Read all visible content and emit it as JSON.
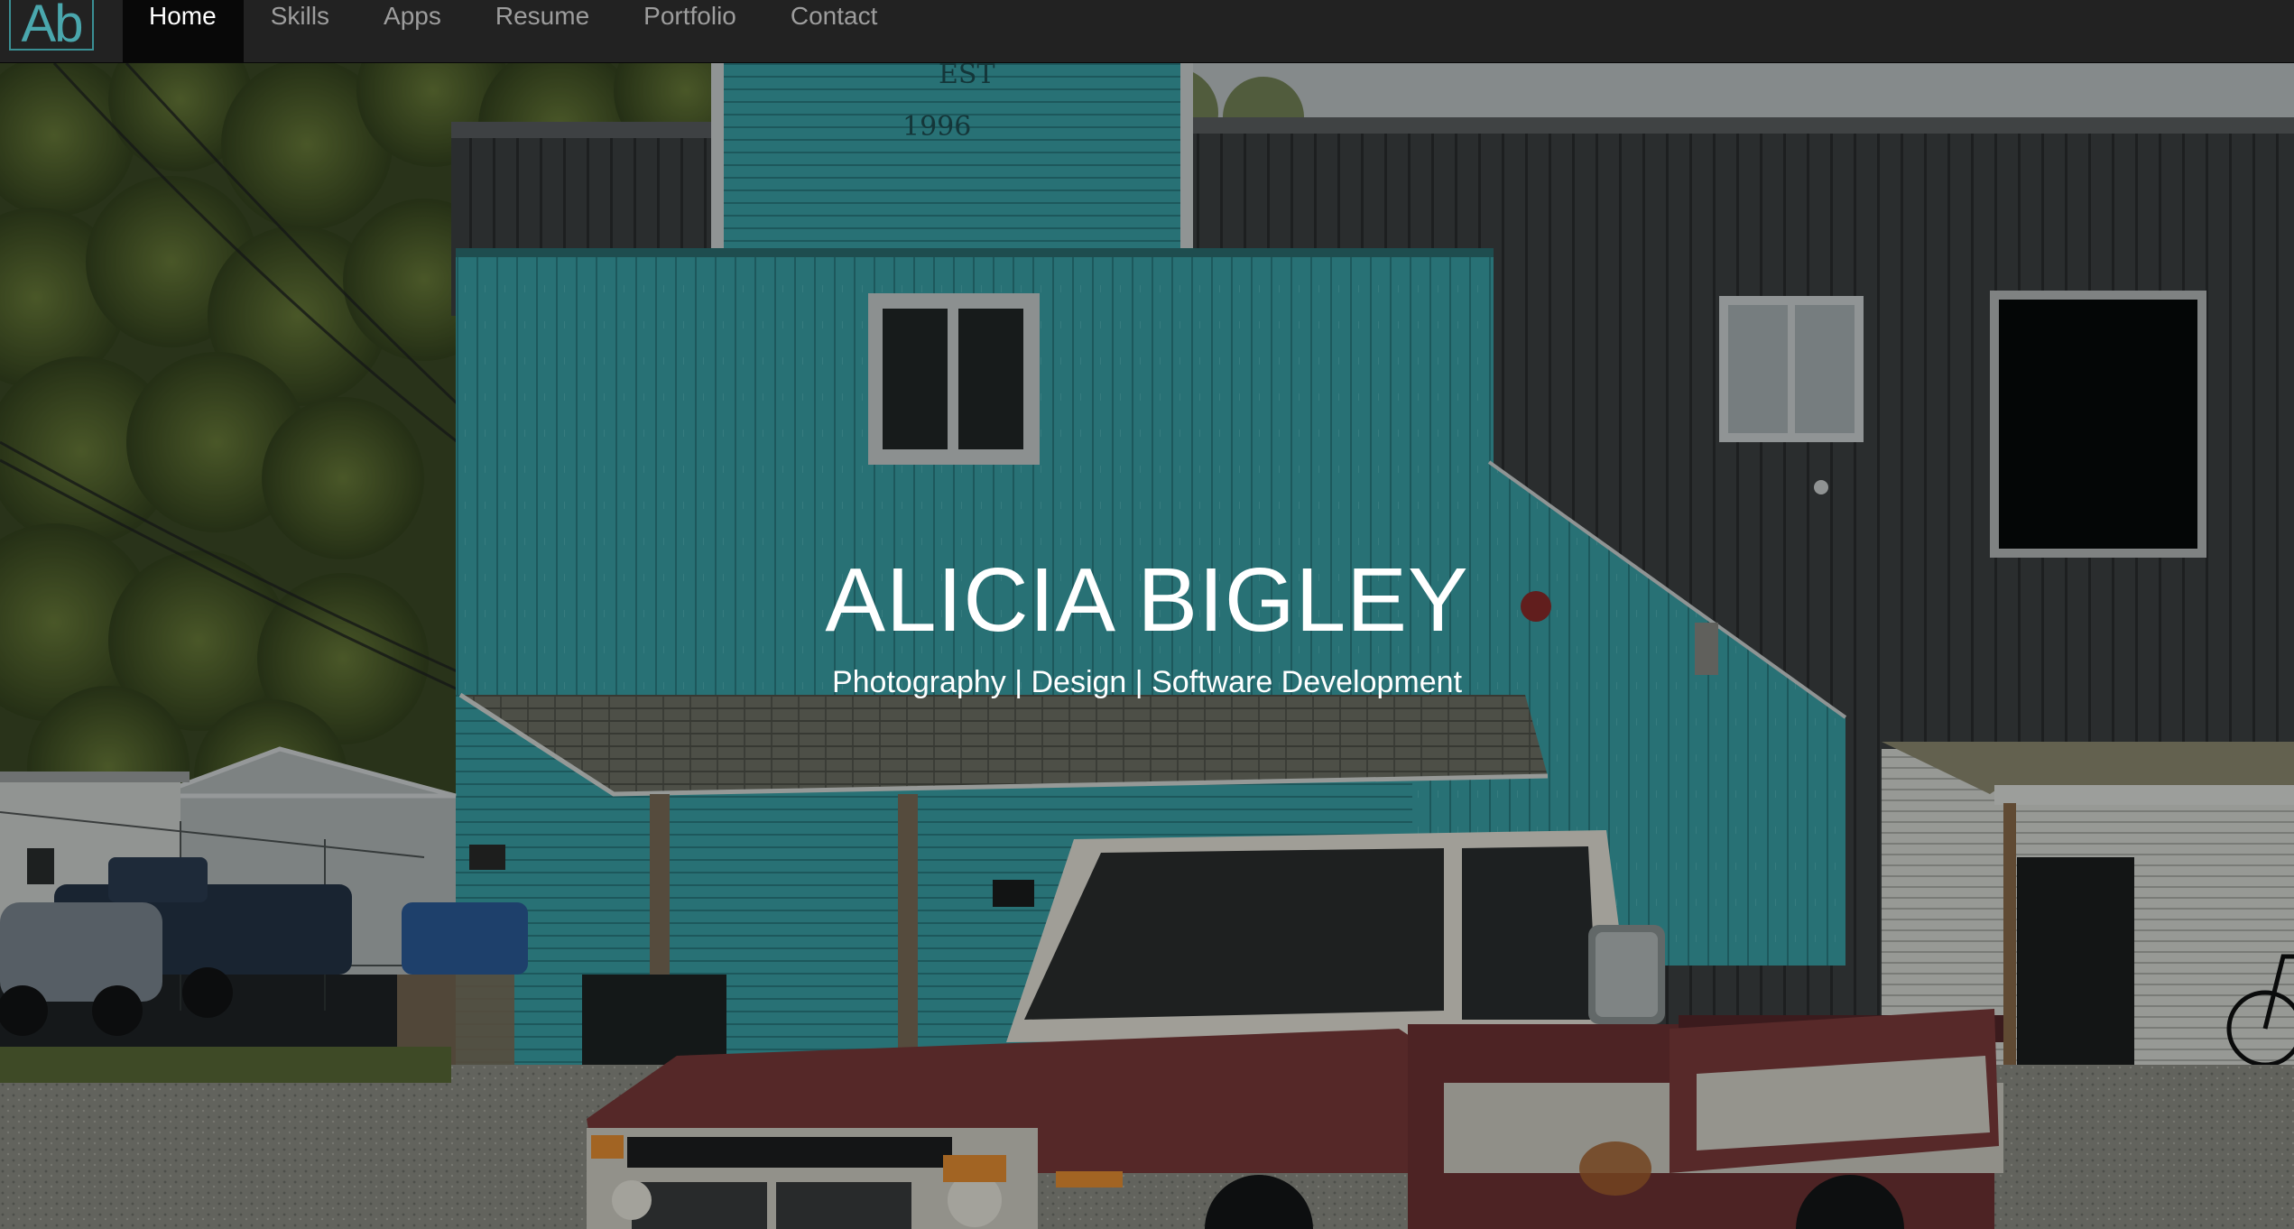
{
  "navbar": {
    "brand": "Ab",
    "items": [
      {
        "label": "Home",
        "active": true
      },
      {
        "label": "Skills",
        "active": false
      },
      {
        "label": "Apps",
        "active": false
      },
      {
        "label": "Resume",
        "active": false
      },
      {
        "label": "Portfolio",
        "active": false
      },
      {
        "label": "Contact",
        "active": false
      }
    ]
  },
  "hero": {
    "title": "ALICIA BIGLEY",
    "subtitle": "Photography | Design | Software Development",
    "background_description_icon": "photo-background",
    "sign_est": "EST",
    "sign_year": "1996"
  },
  "colors": {
    "navbar_bg": "#222222",
    "nav_active_bg": "#080808",
    "nav_text": "#9d9d9d",
    "nav_active_text": "#ffffff",
    "brand_accent": "#3a8f94",
    "teal_building": "#2f8f95",
    "dark_building": "#2b2f30"
  }
}
